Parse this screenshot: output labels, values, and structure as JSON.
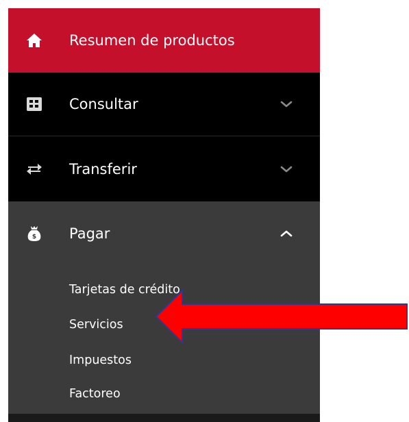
{
  "menu": {
    "items": [
      {
        "label": "Resumen de productos",
        "icon": "home-icon"
      },
      {
        "label": "Consultar",
        "icon": "grid-icon",
        "expanded": false
      },
      {
        "label": "Transferir",
        "icon": "transfer-arrows-icon",
        "expanded": false
      },
      {
        "label": "Pagar",
        "icon": "money-bag-icon",
        "expanded": true
      }
    ],
    "pay_subitems": [
      {
        "label": "Tarjetas de crédito"
      },
      {
        "label": "Servicios"
      },
      {
        "label": "Impuestos"
      },
      {
        "label": "Factoreo"
      }
    ]
  },
  "annotation": {
    "arrow_color": "#ff0000",
    "arrow_outline": "#2b3a8f",
    "points_to": "Servicios"
  },
  "colors": {
    "active_item_bg": "#c5102b",
    "menu_bg": "#000000",
    "expanded_section_bg": "#3b3b3b",
    "text": "#ffffff"
  }
}
